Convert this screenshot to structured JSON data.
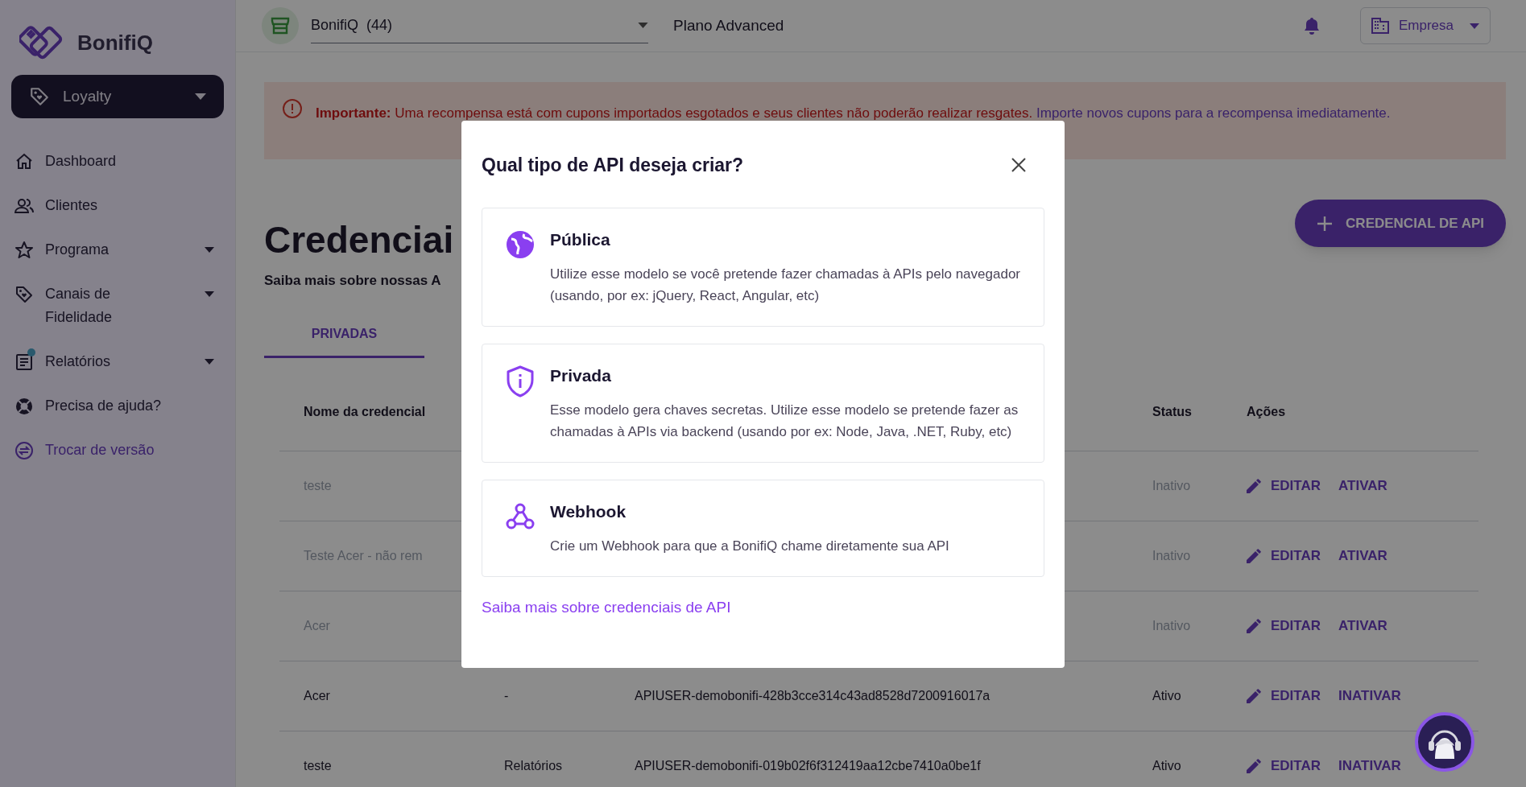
{
  "sidebar": {
    "logo": "BonifiQ",
    "product_selector": "Loyalty",
    "items": [
      {
        "label": "Dashboard",
        "kind": "home",
        "expandable": false,
        "notification": false,
        "accent": false
      },
      {
        "label": "Clientes",
        "kind": "people",
        "expandable": false,
        "notification": false,
        "accent": false
      },
      {
        "label": "Programa",
        "kind": "star",
        "expandable": true,
        "notification": false,
        "accent": false
      },
      {
        "label": "Canais de Fidelidade",
        "kind": "tag",
        "expandable": true,
        "notification": false,
        "accent": false
      },
      {
        "label": "Relatórios",
        "kind": "report",
        "expandable": true,
        "notification": true,
        "accent": false
      },
      {
        "label": "Precisa de ajuda?",
        "kind": "help",
        "expandable": false,
        "notification": false,
        "accent": false
      },
      {
        "label": "Trocar de versão",
        "kind": "swap",
        "expandable": false,
        "notification": false,
        "accent": true
      }
    ]
  },
  "top_bar": {
    "store": "BonifiQ  (44)",
    "plan": "Plano Advanced",
    "account": "Empresa"
  },
  "banner": {
    "message": "**Importante:** Uma recompensa está com cupons importados esgotados e seus clientes não poderão realizar resgates.",
    "link": "Importe novos cupons para a recompensa imediatamente."
  },
  "page": {
    "title": "Credenciai",
    "subtitle": "Saiba mais sobre nossas A",
    "add_button": "CREDENCIAL DE API",
    "tabs": [
      {
        "label": "PRIVADAS",
        "selected": true
      }
    ],
    "table": {
      "columns": [
        {
          "label": "Nome da credencial"
        },
        {
          "label": "Status"
        },
        {
          "label": "Ações"
        }
      ],
      "rows": [
        {
          "name": "teste",
          "status": "Inativo",
          "active": false,
          "actions": [
            "EDITAR",
            "ATIVAR"
          ]
        },
        {
          "name": "Teste Acer - não rem",
          "status": "Inativo",
          "active": false,
          "actions": [
            "EDITAR",
            "ATIVAR"
          ]
        },
        {
          "name": "Acer",
          "status": "Inativo",
          "active": false,
          "actions": [
            "EDITAR",
            "ATIVAR"
          ]
        },
        {
          "name": "Acer",
          "app": "-",
          "key": "APIUSER-demobonifi-428b3cce314c43ad8528d7200916017a",
          "status": "Ativo",
          "active": true,
          "actions": [
            "EDITAR",
            "INATIVAR"
          ]
        },
        {
          "name": "teste",
          "app": "Relatórios",
          "key": "APIUSER-demobonifi-019b02f6f312419aa12cbe7410a0be1f",
          "status": "Ativo",
          "active": true,
          "actions": [
            "EDITAR",
            "INATIVAR"
          ]
        }
      ]
    }
  },
  "modal": {
    "title": "Qual tipo de API deseja criar?",
    "options": [
      {
        "kind": "globe",
        "title": "Pública",
        "description": "Utilize esse modelo se você pretende fazer chamadas à APIs pelo navegador (usando, por ex: jQuery, React, Angular, etc)"
      },
      {
        "kind": "shield",
        "title": "Privada",
        "description": "Esse modelo gera chaves secretas. Utilize esse modelo se pretende fazer as chamadas à APIs via backend (usando por ex: Node, Java, .NET, Ruby, etc)"
      },
      {
        "kind": "webhook",
        "title": "Webhook",
        "description": "Crie um Webhook para que a BonifiQ chame diretamente sua API"
      }
    ],
    "link": "Saiba mais sobre credenciais de API"
  }
}
